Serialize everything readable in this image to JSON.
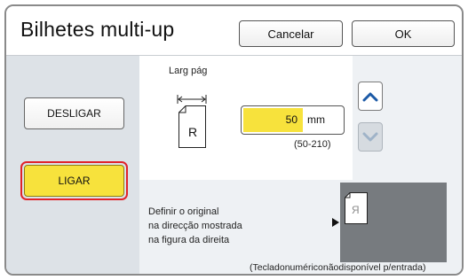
{
  "dialog": {
    "title": "Bilhetes multi-up",
    "cancel_label": "Cancelar",
    "ok_label": "OK"
  },
  "mode": {
    "off_label": "DESLIGAR",
    "on_label": "LIGAR",
    "selected": "LIGAR"
  },
  "page_width": {
    "label": "Larg pág",
    "preview_letter": "R",
    "value": "50",
    "unit": "mm",
    "range": "(50-210)"
  },
  "spinner": {
    "up_icon": "chevron-up-icon",
    "down_icon": "chevron-down-icon"
  },
  "instruction": {
    "line1": "Definir o original",
    "line2": "na direcção mostrada",
    "line3": "na figura da direita"
  },
  "original_preview": {
    "letter": "R"
  },
  "footnote": "(Tecladonumériconãodisponível p/entrada)",
  "colors": {
    "accent_yellow": "#f7e23c",
    "selection_red": "#e0232a",
    "preview_gray": "#777b7f"
  }
}
